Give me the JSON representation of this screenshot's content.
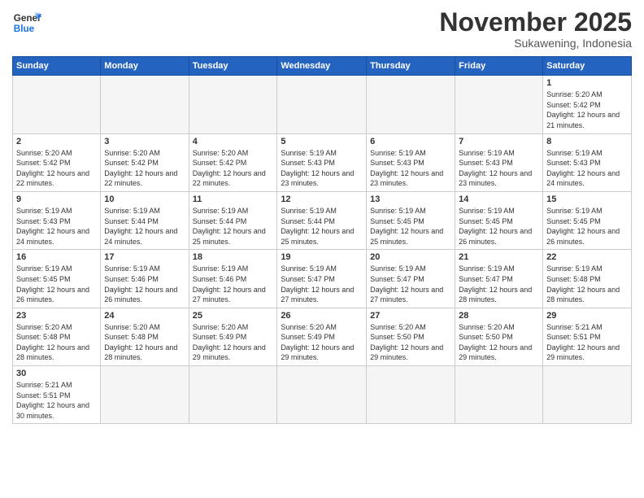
{
  "logo": {
    "general": "General",
    "blue": "Blue"
  },
  "header": {
    "month": "November 2025",
    "location": "Sukawening, Indonesia"
  },
  "weekdays": [
    "Sunday",
    "Monday",
    "Tuesday",
    "Wednesday",
    "Thursday",
    "Friday",
    "Saturday"
  ],
  "weeks": [
    [
      {
        "day": "",
        "info": ""
      },
      {
        "day": "",
        "info": ""
      },
      {
        "day": "",
        "info": ""
      },
      {
        "day": "",
        "info": ""
      },
      {
        "day": "",
        "info": ""
      },
      {
        "day": "",
        "info": ""
      },
      {
        "day": "1",
        "info": "Sunrise: 5:20 AM\nSunset: 5:42 PM\nDaylight: 12 hours and 21 minutes."
      }
    ],
    [
      {
        "day": "2",
        "info": "Sunrise: 5:20 AM\nSunset: 5:42 PM\nDaylight: 12 hours and 22 minutes."
      },
      {
        "day": "3",
        "info": "Sunrise: 5:20 AM\nSunset: 5:42 PM\nDaylight: 12 hours and 22 minutes."
      },
      {
        "day": "4",
        "info": "Sunrise: 5:20 AM\nSunset: 5:42 PM\nDaylight: 12 hours and 22 minutes."
      },
      {
        "day": "5",
        "info": "Sunrise: 5:19 AM\nSunset: 5:43 PM\nDaylight: 12 hours and 23 minutes."
      },
      {
        "day": "6",
        "info": "Sunrise: 5:19 AM\nSunset: 5:43 PM\nDaylight: 12 hours and 23 minutes."
      },
      {
        "day": "7",
        "info": "Sunrise: 5:19 AM\nSunset: 5:43 PM\nDaylight: 12 hours and 23 minutes."
      },
      {
        "day": "8",
        "info": "Sunrise: 5:19 AM\nSunset: 5:43 PM\nDaylight: 12 hours and 24 minutes."
      }
    ],
    [
      {
        "day": "9",
        "info": "Sunrise: 5:19 AM\nSunset: 5:43 PM\nDaylight: 12 hours and 24 minutes."
      },
      {
        "day": "10",
        "info": "Sunrise: 5:19 AM\nSunset: 5:44 PM\nDaylight: 12 hours and 24 minutes."
      },
      {
        "day": "11",
        "info": "Sunrise: 5:19 AM\nSunset: 5:44 PM\nDaylight: 12 hours and 25 minutes."
      },
      {
        "day": "12",
        "info": "Sunrise: 5:19 AM\nSunset: 5:44 PM\nDaylight: 12 hours and 25 minutes."
      },
      {
        "day": "13",
        "info": "Sunrise: 5:19 AM\nSunset: 5:45 PM\nDaylight: 12 hours and 25 minutes."
      },
      {
        "day": "14",
        "info": "Sunrise: 5:19 AM\nSunset: 5:45 PM\nDaylight: 12 hours and 26 minutes."
      },
      {
        "day": "15",
        "info": "Sunrise: 5:19 AM\nSunset: 5:45 PM\nDaylight: 12 hours and 26 minutes."
      }
    ],
    [
      {
        "day": "16",
        "info": "Sunrise: 5:19 AM\nSunset: 5:45 PM\nDaylight: 12 hours and 26 minutes."
      },
      {
        "day": "17",
        "info": "Sunrise: 5:19 AM\nSunset: 5:46 PM\nDaylight: 12 hours and 26 minutes."
      },
      {
        "day": "18",
        "info": "Sunrise: 5:19 AM\nSunset: 5:46 PM\nDaylight: 12 hours and 27 minutes."
      },
      {
        "day": "19",
        "info": "Sunrise: 5:19 AM\nSunset: 5:47 PM\nDaylight: 12 hours and 27 minutes."
      },
      {
        "day": "20",
        "info": "Sunrise: 5:19 AM\nSunset: 5:47 PM\nDaylight: 12 hours and 27 minutes."
      },
      {
        "day": "21",
        "info": "Sunrise: 5:19 AM\nSunset: 5:47 PM\nDaylight: 12 hours and 28 minutes."
      },
      {
        "day": "22",
        "info": "Sunrise: 5:19 AM\nSunset: 5:48 PM\nDaylight: 12 hours and 28 minutes."
      }
    ],
    [
      {
        "day": "23",
        "info": "Sunrise: 5:20 AM\nSunset: 5:48 PM\nDaylight: 12 hours and 28 minutes."
      },
      {
        "day": "24",
        "info": "Sunrise: 5:20 AM\nSunset: 5:48 PM\nDaylight: 12 hours and 28 minutes."
      },
      {
        "day": "25",
        "info": "Sunrise: 5:20 AM\nSunset: 5:49 PM\nDaylight: 12 hours and 29 minutes."
      },
      {
        "day": "26",
        "info": "Sunrise: 5:20 AM\nSunset: 5:49 PM\nDaylight: 12 hours and 29 minutes."
      },
      {
        "day": "27",
        "info": "Sunrise: 5:20 AM\nSunset: 5:50 PM\nDaylight: 12 hours and 29 minutes."
      },
      {
        "day": "28",
        "info": "Sunrise: 5:20 AM\nSunset: 5:50 PM\nDaylight: 12 hours and 29 minutes."
      },
      {
        "day": "29",
        "info": "Sunrise: 5:21 AM\nSunset: 5:51 PM\nDaylight: 12 hours and 29 minutes."
      }
    ],
    [
      {
        "day": "30",
        "info": "Sunrise: 5:21 AM\nSunset: 5:51 PM\nDaylight: 12 hours and 30 minutes."
      },
      {
        "day": "",
        "info": ""
      },
      {
        "day": "",
        "info": ""
      },
      {
        "day": "",
        "info": ""
      },
      {
        "day": "",
        "info": ""
      },
      {
        "day": "",
        "info": ""
      },
      {
        "day": "",
        "info": ""
      }
    ]
  ]
}
